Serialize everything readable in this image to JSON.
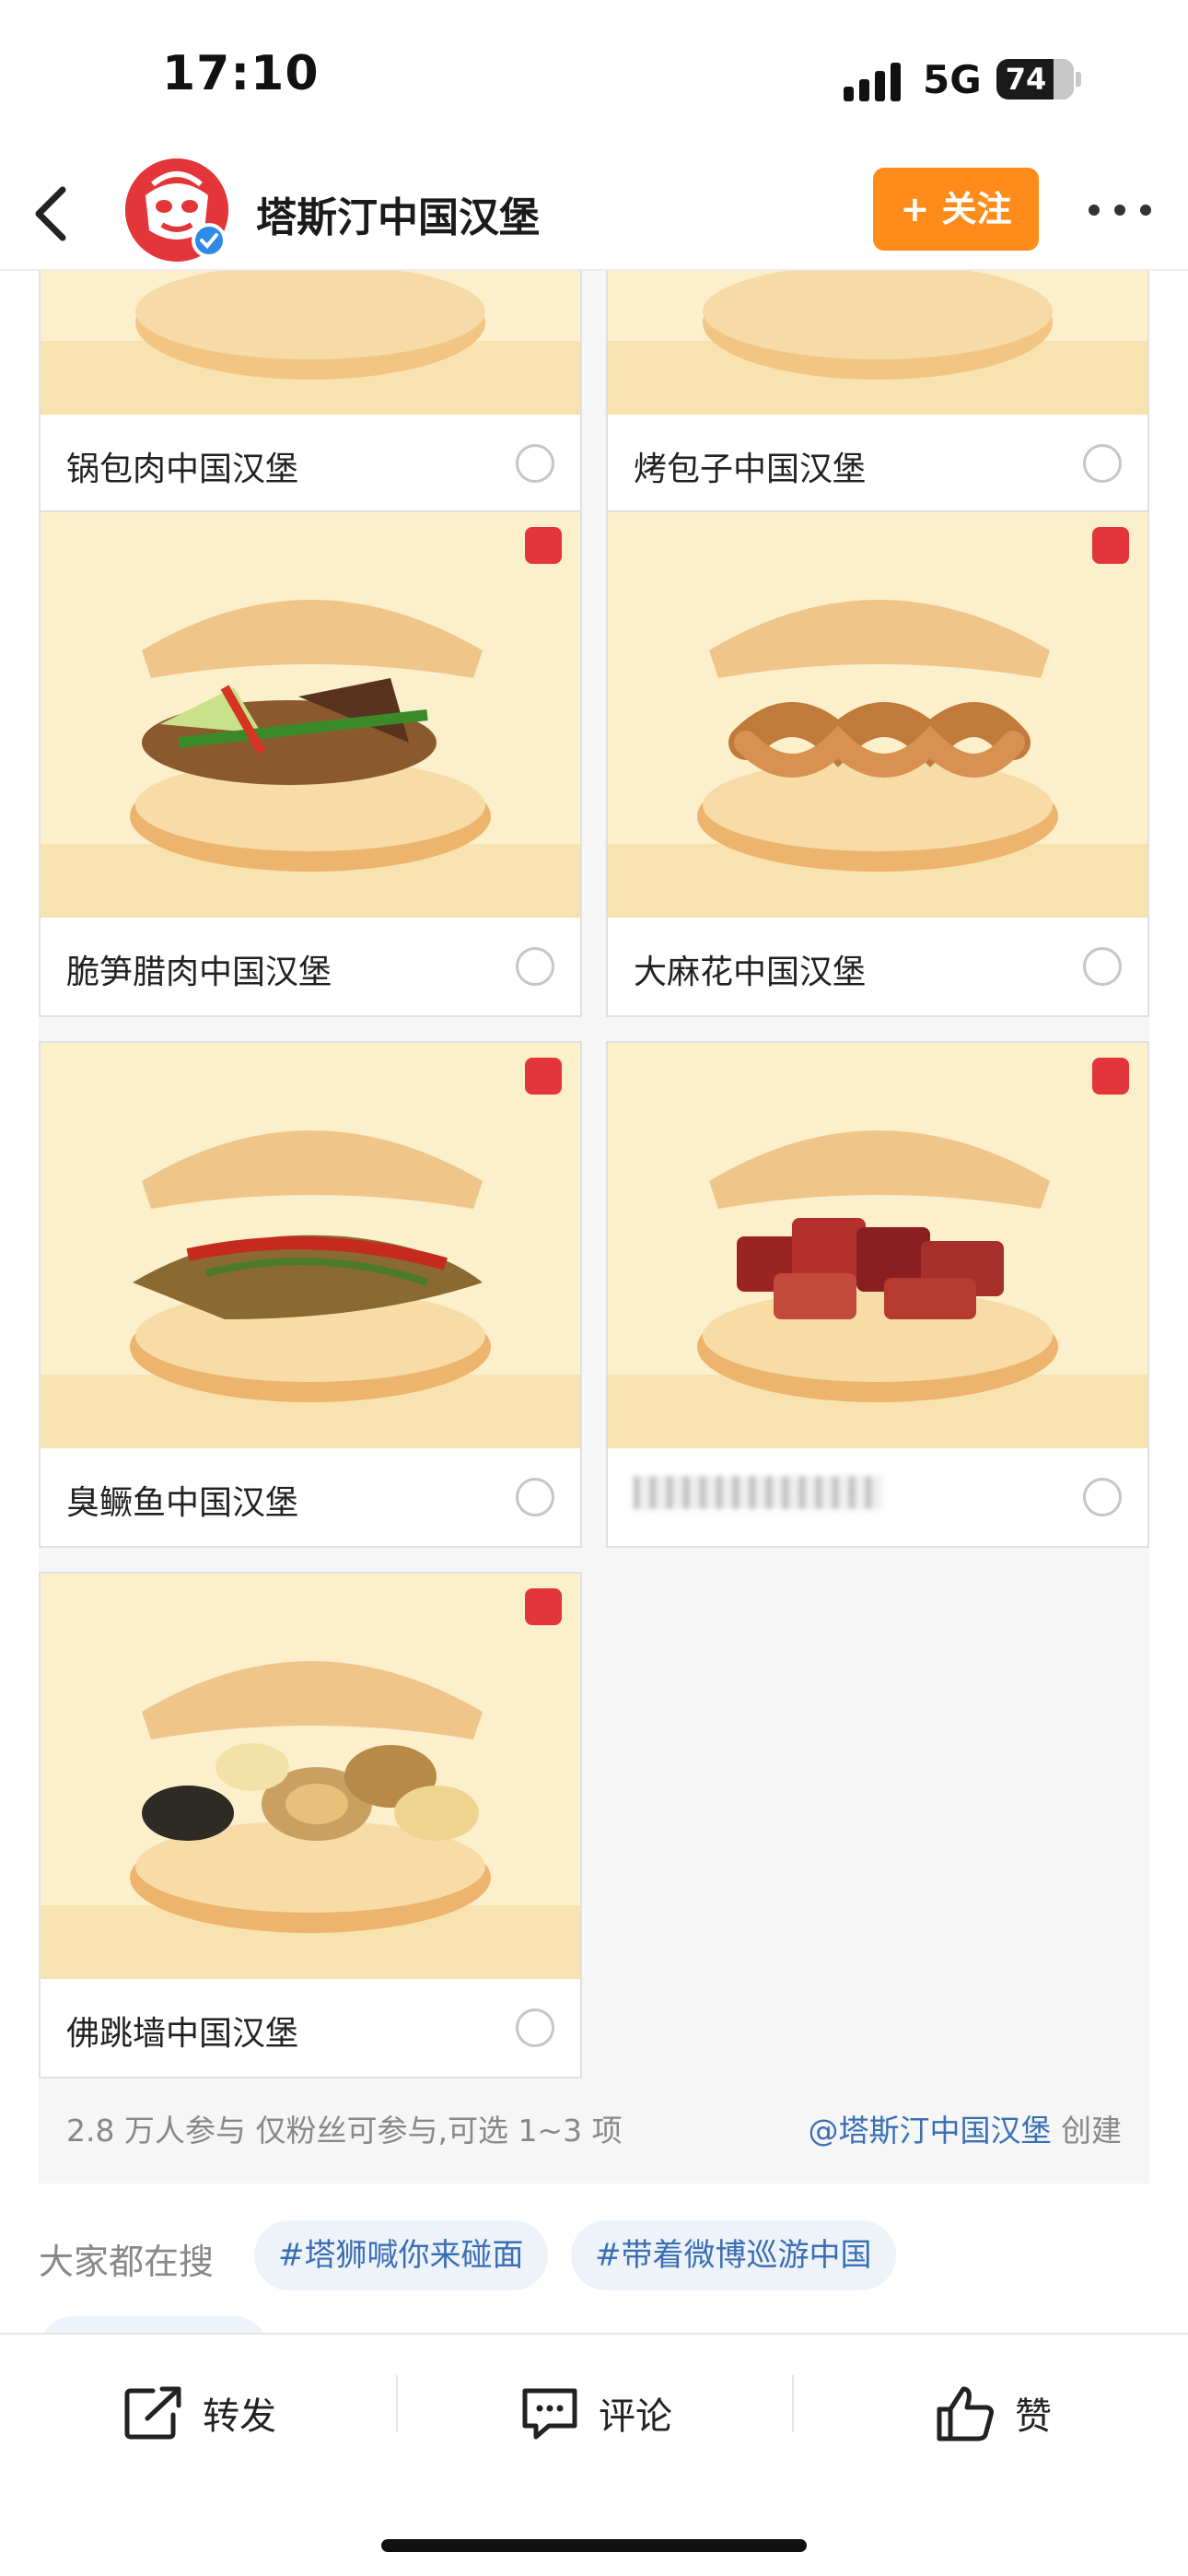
{
  "status_bar": {
    "time": "17:10",
    "network": "5G",
    "battery": "74"
  },
  "header": {
    "account_name": "塔斯汀中国汉堡",
    "follow_label": "+ 关注"
  },
  "poll": {
    "options": [
      {
        "label": "锅包肉中国汉堡",
        "filling": "pork-strips"
      },
      {
        "label": "烤包子中国汉堡",
        "filling": "baozi"
      },
      {
        "label": "脆笋腊肉中国汉堡",
        "filling": "bamboo-bacon"
      },
      {
        "label": "大麻花中国汉堡",
        "filling": "mahua"
      },
      {
        "label": "臭鳜鱼中国汉堡",
        "filling": "fish"
      },
      {
        "label": "",
        "filling": "braised-pork",
        "blurred": true
      },
      {
        "label": "佛跳墙中国汉堡",
        "filling": "seafood"
      }
    ],
    "participants": "2.8 万人参与    仅粉丝可参与,可选 1~3 项",
    "creator_handle": "@塔斯汀中国汉堡",
    "creator_suffix": " 创建"
  },
  "suggest": {
    "label": "大家都在搜",
    "tags": [
      "#塔狮喊你来碰面",
      "#带着微博巡游中国"
    ]
  },
  "actions": {
    "repost": "转发",
    "comment": "评论",
    "like": "赞"
  },
  "colors": {
    "accent": "#ff8c1a",
    "link": "#3a6fb5",
    "brand_red": "#e4363a"
  }
}
